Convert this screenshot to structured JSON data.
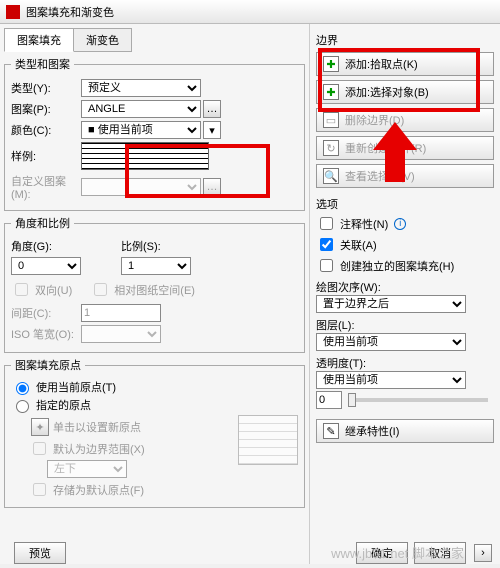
{
  "title": "图案填充和渐变色",
  "tabs": {
    "hatch": "图案填充",
    "gradient": "渐变色"
  },
  "typepat": {
    "legend": "类型和图案",
    "type_lbl": "类型(Y):",
    "type_val": "预定义",
    "pattern_lbl": "图案(P):",
    "pattern_val": "ANGLE",
    "color_lbl": "颜色(C):",
    "color_val": "■ 使用当前项",
    "sample_lbl": "样例:",
    "custom_lbl": "自定义图案(M):"
  },
  "anglescale": {
    "legend": "角度和比例",
    "angle_lbl": "角度(G):",
    "angle_val": "0",
    "scale_lbl": "比例(S):",
    "scale_val": "1",
    "double": "双向(U)",
    "paperspace": "相对图纸空间(E)",
    "gap_lbl": "间距(C):",
    "gap_val": "1",
    "iso_lbl": "ISO 笔宽(O):"
  },
  "origin": {
    "legend": "图案填充原点",
    "use_current": "使用当前原点(T)",
    "specified": "指定的原点",
    "click": "单击以设置新原点",
    "default_ext": "默认为边界范围(X)",
    "pos": "左下",
    "store": "存储为默认原点(F)"
  },
  "right": {
    "boundary": "边界",
    "add_pick": "添加:拾取点(K)",
    "add_select": "添加:选择对象(B)",
    "remove": "删除边界(D)",
    "recreate": "重新创建边界(R)",
    "view": "查看选择集(V)",
    "options": "选项",
    "annotative": "注释性(N)",
    "associative": "关联(A)",
    "independent": "创建独立的图案填充(H)",
    "draworder": "绘图次序(W):",
    "draworder_val": "置于边界之后",
    "layer": "图层(L):",
    "layer_val": "使用当前项",
    "transparency": "透明度(T):",
    "trans_val": "使用当前项",
    "trans_num": "0",
    "inherit": "继承特性(I)"
  },
  "footer": {
    "preview": "预览",
    "ok": "确定",
    "cancel": "取消"
  },
  "watermark": "www.jb51.net 脚本之家"
}
